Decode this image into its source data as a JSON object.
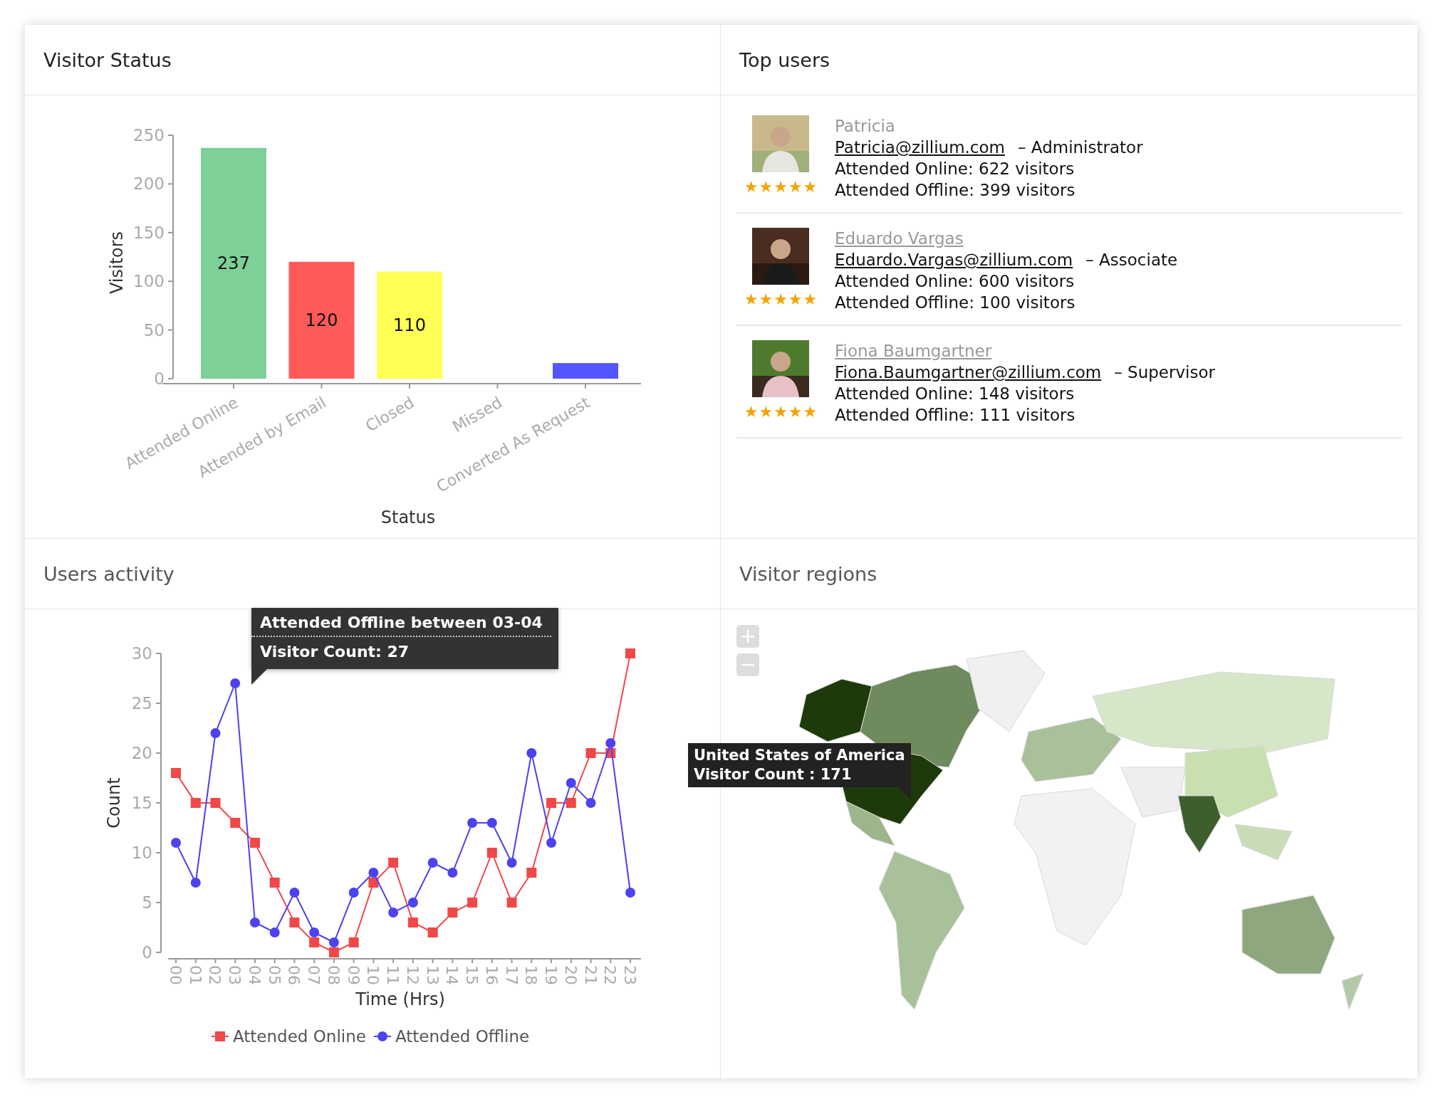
{
  "visitor_status": {
    "title": "Visitor Status",
    "chart_data": {
      "type": "bar",
      "xlabel": "Status",
      "ylabel": "Visitors",
      "categories": [
        "Attended Online",
        "Attended by Email",
        "Closed",
        "Missed",
        "Converted As Request"
      ],
      "values": [
        237,
        120,
        110,
        null,
        16
      ],
      "colors": [
        "#7dd098",
        "#ff5a5a",
        "#ffff55",
        null,
        "#5555ff"
      ],
      "ylim": [
        0,
        250
      ],
      "yticks": [
        0,
        50,
        100,
        150,
        200,
        250
      ],
      "value_labels": [
        "237",
        "120",
        "110",
        null,
        null
      ]
    }
  },
  "top_users": {
    "title": "Top users",
    "users": [
      {
        "name": "Patricia",
        "linked": false,
        "email": "Patricia@zillium.com",
        "role": "– Administrator",
        "online": "Attended Online: 622 visitors",
        "offline": "Attended Offline: 399 visitors",
        "stars": 5
      },
      {
        "name": "Eduardo Vargas",
        "linked": true,
        "email": "Eduardo.Vargas@zillium.com",
        "role": "– Associate",
        "online": "Attended Online: 600 visitors",
        "offline": "Attended Offline: 100 visitors",
        "stars": 5
      },
      {
        "name": "Fiona Baumgartner",
        "linked": true,
        "email": "Fiona.Baumgartner@zillium.com",
        "role": "– Supervisor",
        "online": "Attended Online: 148 visitors",
        "offline": "Attended Offline: 111 visitors",
        "stars": 5
      }
    ]
  },
  "users_activity": {
    "title": "Users activity",
    "chart_data": {
      "type": "line",
      "xlabel": "Time (Hrs)",
      "ylabel": "Count",
      "categories": [
        "00",
        "01",
        "02",
        "03",
        "04",
        "05",
        "06",
        "07",
        "08",
        "09",
        "10",
        "11",
        "12",
        "13",
        "14",
        "15",
        "16",
        "17",
        "18",
        "19",
        "20",
        "21",
        "22",
        "23"
      ],
      "ylim": [
        0,
        30
      ],
      "yticks": [
        0,
        5,
        10,
        15,
        20,
        25,
        30
      ],
      "legend": true,
      "series": [
        {
          "name": "Attended Online",
          "color": "#f04848",
          "marker": "square",
          "values": [
            18,
            15,
            15,
            13,
            11,
            7,
            3,
            1,
            0,
            1,
            7,
            9,
            3,
            2,
            4,
            5,
            10,
            5,
            8,
            15,
            15,
            20,
            20,
            30
          ]
        },
        {
          "name": "Attended Offline",
          "color": "#4c42f0",
          "marker": "circle",
          "values": [
            11,
            7,
            22,
            27,
            3,
            2,
            6,
            2,
            1,
            6,
            8,
            4,
            5,
            9,
            8,
            13,
            13,
            9,
            20,
            11,
            17,
            15,
            21,
            6
          ]
        }
      ]
    },
    "tooltip": {
      "title": "Attended Offline between 03-04",
      "line": "Visitor Count: 27"
    }
  },
  "visitor_regions": {
    "title": "Visitor regions",
    "zoom_in": "+",
    "zoom_out": "−",
    "tooltip": {
      "country": "United States of America",
      "line": "Visitor Count : 171"
    }
  }
}
